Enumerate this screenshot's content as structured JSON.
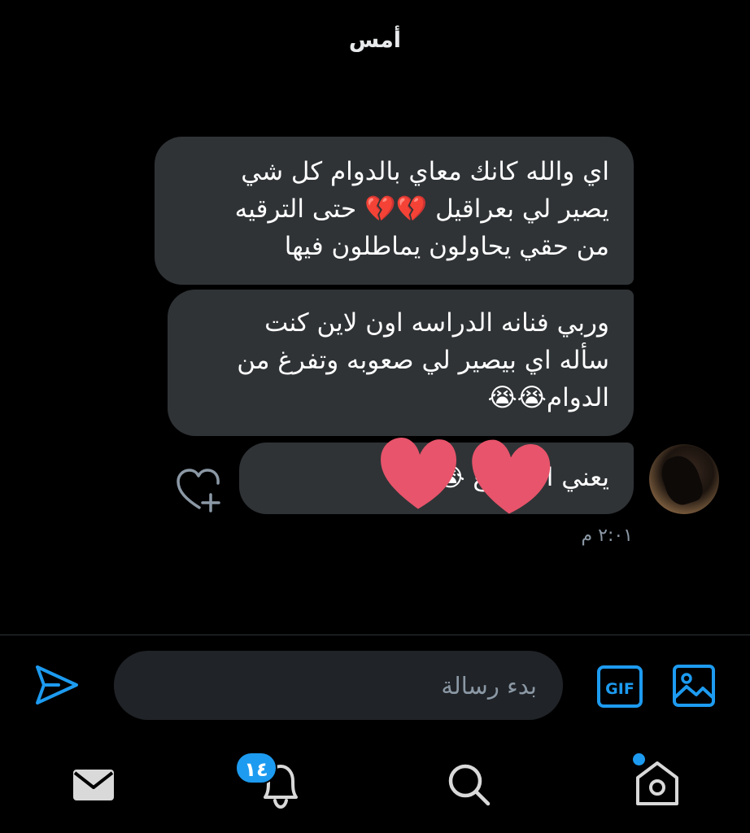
{
  "header": {
    "date_label": "أمس"
  },
  "messages": [
    {
      "lines": [
        "اي والله كانك معاي بالدوام كل شي",
        "يصير لي بعراقيل 💔💔 حتى الترقيه",
        "من حقي يحاولون يماطلون فيها"
      ]
    },
    {
      "lines": [
        "وربي فنانه الدراسه اون لاين كنت",
        "سأله اي بيصير لي صعوبه وتفرغ من",
        "الدوام😭😭"
      ]
    },
    {
      "lines": [
        "يعني ا… …ع 😭😭"
      ]
    }
  ],
  "timestamp": "٢:٠١ م",
  "composer": {
    "placeholder": "بدء رسالة",
    "gif_label": "GIF"
  },
  "nav": {
    "notifications_badge": "١٤"
  },
  "colors": {
    "accent": "#1d9bf0",
    "bubble": "#2f3336",
    "sticker_heart": "#e8546b"
  },
  "icons": [
    "heart-plus-icon",
    "send-icon",
    "gif-icon",
    "image-icon",
    "mail-icon",
    "bell-icon",
    "search-icon",
    "home-icon"
  ]
}
